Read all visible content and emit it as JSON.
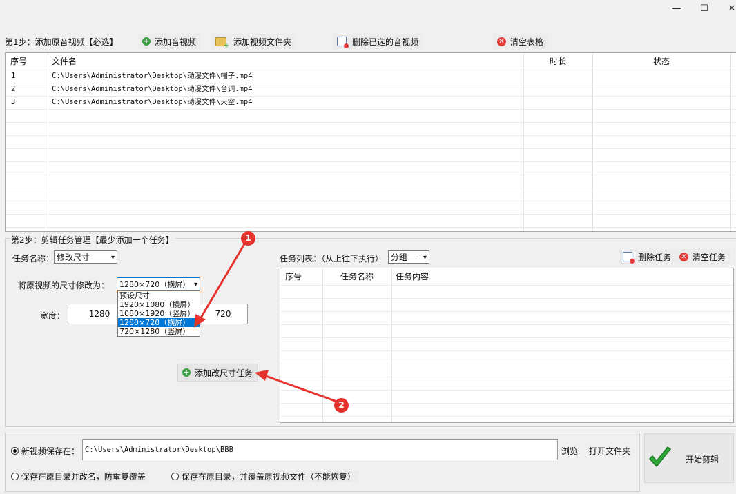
{
  "window": {
    "minimize": "—",
    "maximize": "☐",
    "close": "✕"
  },
  "step1": {
    "label": "第1步：添加原音视频【必选】",
    "add_av": "添加音视频",
    "add_folder": "添加视频文件夹",
    "delete_selected": "删除已选的音视频",
    "clear_table": "清空表格",
    "columns": [
      "序号",
      "文件名",
      "时长",
      "状态"
    ],
    "rows": [
      {
        "no": "1",
        "file": "C:\\Users\\Administrator\\Desktop\\动漫文件\\帽子.mp4",
        "duration": "",
        "status": ""
      },
      {
        "no": "2",
        "file": "C:\\Users\\Administrator\\Desktop\\动漫文件\\台词.mp4",
        "duration": "",
        "status": ""
      },
      {
        "no": "3",
        "file": "C:\\Users\\Administrator\\Desktop\\动漫文件\\天空.mp4",
        "duration": "",
        "status": ""
      }
    ]
  },
  "step2": {
    "label": "第2步：剪辑任务管理【最少添加一个任务】",
    "task_name_label": "任务名称：",
    "task_name_value": "修改尺寸",
    "resize_label": "将原视频的尺寸修改为：",
    "resize_value": "1280×720（横屏）",
    "resize_options": [
      "预设尺寸",
      "1920×1080（横屏）",
      "1080×1920（竖屏）",
      "1280×720（横屏）",
      "720×1280（竖屏）"
    ],
    "width_label": "宽度：",
    "width_value": "1280",
    "height_value": "720",
    "add_task_button": "添加改尺寸任务",
    "task_list_label": "任务列表：（从上往下执行）",
    "group_value": "分组一",
    "delete_task": "删除任务",
    "clear_task": "清空任务",
    "task_columns": [
      "序号",
      "任务名称",
      "任务内容"
    ]
  },
  "output": {
    "save_new_label": "新视频保存在：",
    "save_path": "C:\\Users\\Administrator\\Desktop\\BBB",
    "browse": "浏览",
    "open_folder": "打开文件夹",
    "option_rename": "保存在原目录并改名，防重复覆盖",
    "option_overwrite": "保存在原目录，并覆盖原视频文件（不能恢复）",
    "start_button": "开始剪辑"
  },
  "annotations": {
    "badge1": "1",
    "badge2": "2"
  },
  "colors": {
    "accent_red": "#e5322d",
    "selection_blue": "#0078d7",
    "add_green": "#3ba245"
  }
}
